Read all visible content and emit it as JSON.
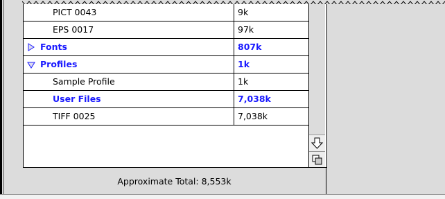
{
  "rows": [
    {
      "name": "PICT 0043",
      "size": "9k",
      "style": "normal",
      "indent": 2
    },
    {
      "name": "EPS 0017",
      "size": "97k",
      "style": "normal",
      "indent": 2
    },
    {
      "name": "Fonts",
      "size": "807k",
      "style": "bold",
      "indent": 1,
      "toggle": "collapsed"
    },
    {
      "name": "Profiles",
      "size": "1k",
      "style": "bold",
      "indent": 1,
      "toggle": "expanded"
    },
    {
      "name": "Sample Profile",
      "size": "1k",
      "style": "normal",
      "indent": 2
    },
    {
      "name": "User Files",
      "size": "7,038k",
      "style": "bold",
      "indent": 2
    },
    {
      "name": "TIFF 0025",
      "size": "7,038k",
      "style": "normal",
      "indent": 2
    }
  ],
  "footer": {
    "total_label": "Approximate Total: 8,553k"
  },
  "colors": {
    "accent": "#1a1aff",
    "background": "#dcdcdc"
  },
  "icons": {
    "collapsed": "triangle-right-icon",
    "expanded": "triangle-down-icon",
    "scroll_down": "arrow-down-icon",
    "grow": "resize-icon"
  }
}
